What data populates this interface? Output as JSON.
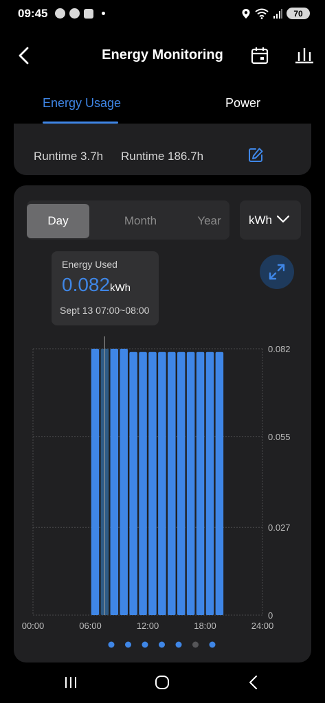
{
  "status_bar": {
    "time": "09:45",
    "battery": "70",
    "icons": [
      "edge-icon",
      "chrome-icon",
      "calendar-notification-icon",
      "location-icon",
      "wifi-icon",
      "signal-icon",
      "battery-icon"
    ]
  },
  "header": {
    "title": "Energy Monitoring",
    "back_icon": "back-arrow-icon",
    "calendar_icon": "calendar-icon",
    "stats_icon": "bar-chart-icon"
  },
  "tabs": [
    {
      "label": "Energy Usage",
      "active": true
    },
    {
      "label": "Power",
      "active": false
    }
  ],
  "runtime": {
    "today": "Runtime 3.7h",
    "total": "Runtime 186.7h",
    "edit_icon": "edit-icon"
  },
  "range_selector": {
    "options": [
      "Day",
      "Month",
      "Year"
    ],
    "selected": "Day"
  },
  "unit_select": {
    "value": "kWh"
  },
  "tooltip": {
    "title": "Energy Used",
    "value": "0.082",
    "unit": "kWh",
    "time_range": "Sept 13 07:00~08:00"
  },
  "colors": {
    "accent": "#3f86e6",
    "background": "#000000",
    "card": "#202022",
    "highlight_bar": "#2e5b86"
  },
  "chart_data": {
    "type": "bar",
    "categories": [
      "00:00",
      "01:00",
      "02:00",
      "03:00",
      "04:00",
      "05:00",
      "06:00",
      "07:00",
      "08:00",
      "09:00",
      "10:00",
      "11:00",
      "12:00",
      "13:00",
      "14:00",
      "15:00",
      "16:00",
      "17:00",
      "18:00",
      "19:00",
      "20:00",
      "21:00",
      "22:00",
      "23:00"
    ],
    "values": [
      0,
      0,
      0,
      0,
      0,
      0,
      0.082,
      0.082,
      0.082,
      0.082,
      0.081,
      0.081,
      0.081,
      0.081,
      0.081,
      0.081,
      0.081,
      0.081,
      0.081,
      0.081,
      0,
      0,
      0,
      0
    ],
    "highlighted_index": 7,
    "x_tick_labels": [
      "00:00",
      "06:00",
      "12:00",
      "18:00",
      "24:00"
    ],
    "y_tick_labels": [
      "0.082",
      "0.055",
      "0.027",
      "0"
    ],
    "ylim": [
      0,
      0.082
    ],
    "grid": true,
    "unit": "kWh"
  },
  "pager": {
    "count": 7,
    "active_index": 5
  },
  "navbar": {
    "icons": [
      "recent-apps-icon",
      "home-icon",
      "back-icon"
    ]
  }
}
